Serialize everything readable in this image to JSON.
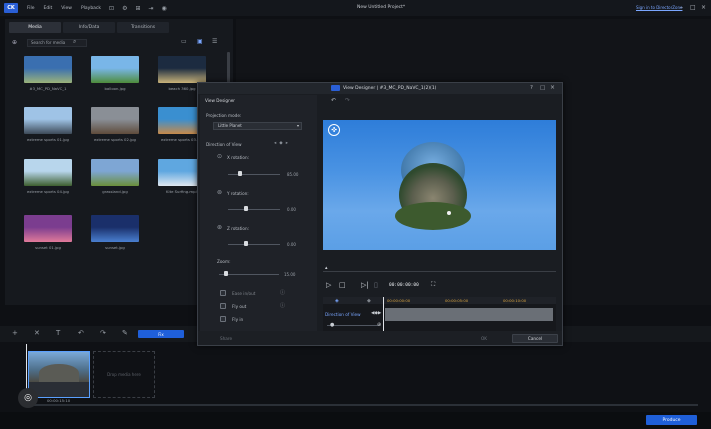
{
  "app": {
    "title": "New Untitled Project*",
    "signin": "Sign in to DirectorZone",
    "menu": [
      "File",
      "Edit",
      "View",
      "Playback"
    ],
    "logo": "CK"
  },
  "library": {
    "tabs": [
      "Media",
      "Info/Data",
      "Transitions"
    ],
    "search_placeholder": "Search for media",
    "items": [
      {
        "label": "#3_MC_PD_NaVC_1",
        "color1": "#3a6fb0",
        "color2": "#9bb37a"
      },
      {
        "label": "balloon.jpg",
        "color1": "#79b6e8",
        "color2": "#4e8c3b"
      },
      {
        "label": "beach 360.jpg",
        "color1": "#1c2b40",
        "color2": "#c9b37a"
      },
      {
        "label": "extreme sports 01.jpg",
        "color1": "#9fc3e6",
        "color2": "#3d4a58"
      },
      {
        "label": "extreme sports 02.jpg",
        "color1": "#8a8f96",
        "color2": "#5e4b3b"
      },
      {
        "label": "extreme sports 03.jpg",
        "color1": "#3a8fd0",
        "color2": "#c78a4a"
      },
      {
        "label": "extreme sports 04.jpg",
        "color1": "#b8d6ec",
        "color2": "#3e5f2f"
      },
      {
        "label": "grassland.jpg",
        "color1": "#7ea6d4",
        "color2": "#6b8f3a"
      },
      {
        "label": "Kite Surfing.mp4",
        "color1": "#5fa7e0",
        "color2": "#dfe7ef"
      },
      {
        "label": "sunset 01.jpg",
        "color1": "#7b3d8f",
        "color2": "#e07a9a"
      },
      {
        "label": "sunset.jpg",
        "color1": "#1a2f6a",
        "color2": "#4a7fd0"
      }
    ]
  },
  "dialog": {
    "title": "View Designer | #3_MC_PD_NaVC_1(2)(1)",
    "panel_title": "View Designer",
    "projection_label": "Projection mode:",
    "projection_value": "Little Planet",
    "direction_label": "Direction of View",
    "x_label": "X rotation:",
    "x_value": "85.00",
    "y_label": "Y rotation:",
    "y_value": "0.00",
    "z_label": "Z rotation:",
    "z_value": "0.00",
    "zoom_label": "Zoom:",
    "zoom_value": "15.00",
    "ease_in": "Ease in/out",
    "fly_out": "Fly out",
    "fly_in": "Fly in",
    "timecode": "00:00:00:00",
    "kf_ticks": [
      "00:00:00:00",
      "00:00:05:00",
      "00:00:10:00"
    ],
    "kf_track": "Direction of View",
    "ok": "OK",
    "cancel": "Cancel",
    "share": "Share"
  },
  "timeline": {
    "clip_timecode": "00:00:15:10",
    "drop_hint": "Drop media here",
    "fix_label": "Fix"
  },
  "produce": "Produce"
}
